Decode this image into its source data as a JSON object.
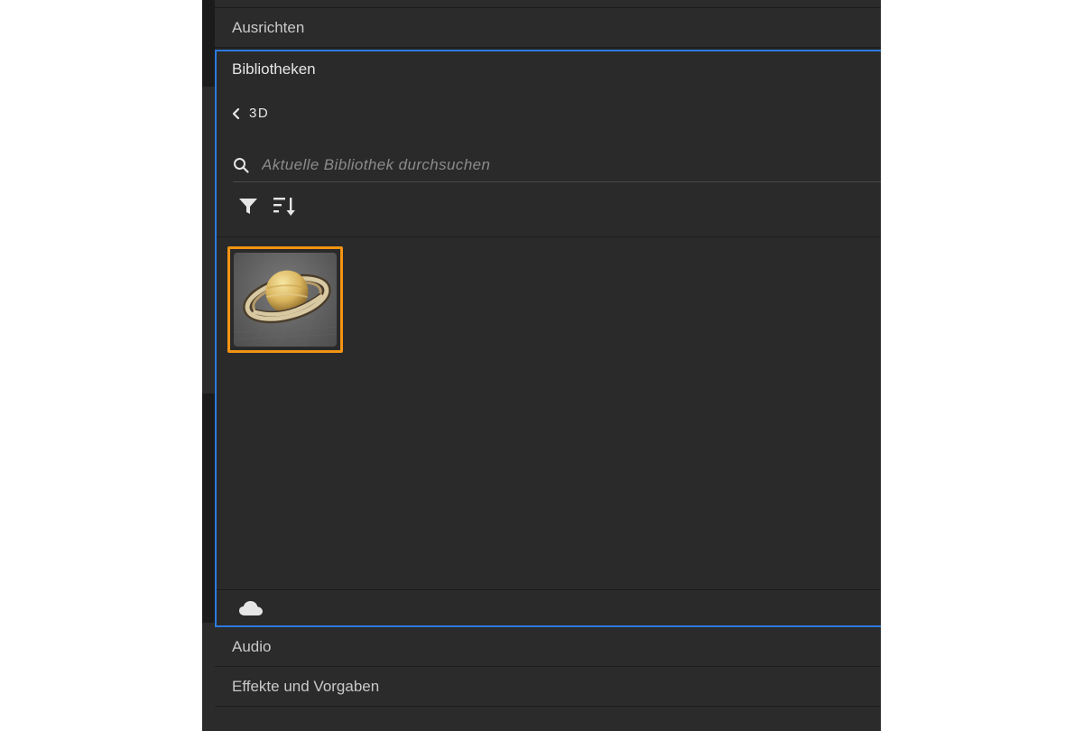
{
  "panels": {
    "align": {
      "label": "Ausrichten"
    },
    "libraries": {
      "title": "Bibliotheken",
      "breadcrumb": "3D",
      "search": {
        "placeholder": "Aktuelle Bibliothek durchsuchen",
        "value": ""
      },
      "assets": [
        {
          "name": "planet-3d-model"
        }
      ],
      "footer_icon": "cloud-icon"
    },
    "audio": {
      "label": "Audio"
    },
    "effects": {
      "label": "Effekte und Vorgaben"
    }
  },
  "colors": {
    "focus_border": "#2d7ae0",
    "selection": "#f29412",
    "background": "#232323"
  },
  "icons": [
    "chevron-left-icon",
    "search-icon",
    "filter-icon",
    "sort-icon",
    "cloud-icon"
  ]
}
